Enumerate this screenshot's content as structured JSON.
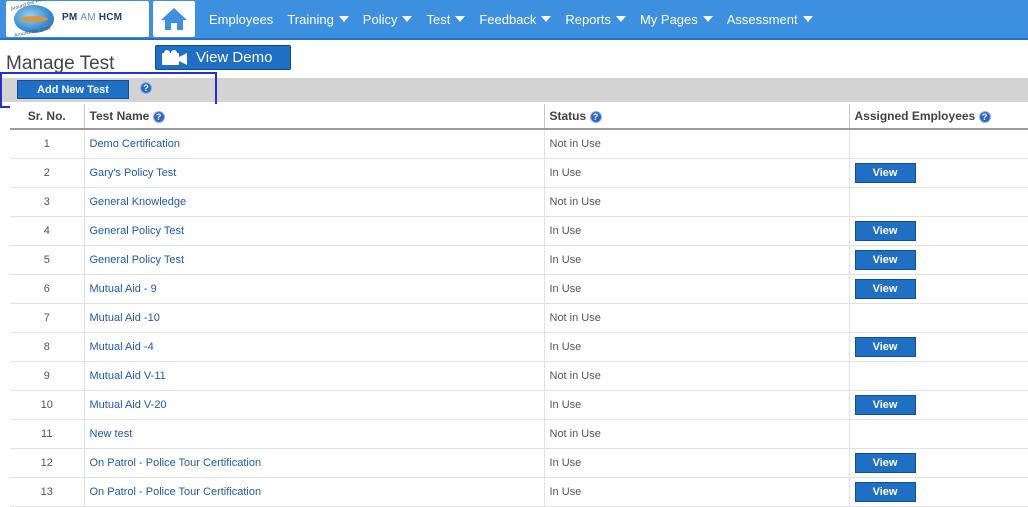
{
  "logo": {
    "brand_pm": "PM",
    "brand_am": "AM",
    "brand_hcm": "HCM",
    "tag_top": "Around the world",
    "tag_bottom": "Around the clock"
  },
  "nav": {
    "items": [
      {
        "label": "Employees",
        "dropdown": false
      },
      {
        "label": "Training",
        "dropdown": true
      },
      {
        "label": "Policy",
        "dropdown": true
      },
      {
        "label": "Test",
        "dropdown": true
      },
      {
        "label": "Feedback",
        "dropdown": true
      },
      {
        "label": "Reports",
        "dropdown": true
      },
      {
        "label": "My Pages",
        "dropdown": true
      },
      {
        "label": "Assessment",
        "dropdown": true
      }
    ]
  },
  "page": {
    "title": "Manage Test",
    "view_demo_label": "View Demo",
    "add_new_test_label": "Add New Test",
    "help_glyph": "?"
  },
  "table": {
    "headers": {
      "sr": "Sr. No.",
      "name": "Test Name",
      "status": "Status",
      "assigned": "Assigned Employees"
    },
    "view_label": "View",
    "rows": [
      {
        "sr": "1",
        "name": "Demo Certification",
        "status": "Not in Use",
        "has_view": false
      },
      {
        "sr": "2",
        "name": "Gary's Policy Test",
        "status": "In Use",
        "has_view": true
      },
      {
        "sr": "3",
        "name": "General Knowledge",
        "status": "Not in Use",
        "has_view": false
      },
      {
        "sr": "4",
        "name": "General Policy Test",
        "status": "In Use",
        "has_view": true
      },
      {
        "sr": "5",
        "name": "General Policy Test",
        "status": "In Use",
        "has_view": true
      },
      {
        "sr": "6",
        "name": "Mutual Aid - 9",
        "status": "In Use",
        "has_view": true
      },
      {
        "sr": "7",
        "name": "Mutual Aid -10",
        "status": "Not in Use",
        "has_view": false
      },
      {
        "sr": "8",
        "name": "Mutual Aid -4",
        "status": "In Use",
        "has_view": true
      },
      {
        "sr": "9",
        "name": "Mutual Aid V-11",
        "status": "Not in Use",
        "has_view": false
      },
      {
        "sr": "10",
        "name": "Mutual Aid V-20",
        "status": "In Use",
        "has_view": true
      },
      {
        "sr": "11",
        "name": "New test",
        "status": "Not in Use",
        "has_view": false
      },
      {
        "sr": "12",
        "name": "On Patrol - Police Tour Certification",
        "status": "In Use",
        "has_view": true
      },
      {
        "sr": "13",
        "name": "On Patrol - Police Tour Certification",
        "status": "In Use",
        "has_view": true
      }
    ]
  },
  "colors": {
    "nav_bg": "#3d8fe0",
    "button_bg": "#1f6fc4",
    "link": "#1f5aa8",
    "highlight_border": "#2233cc"
  }
}
